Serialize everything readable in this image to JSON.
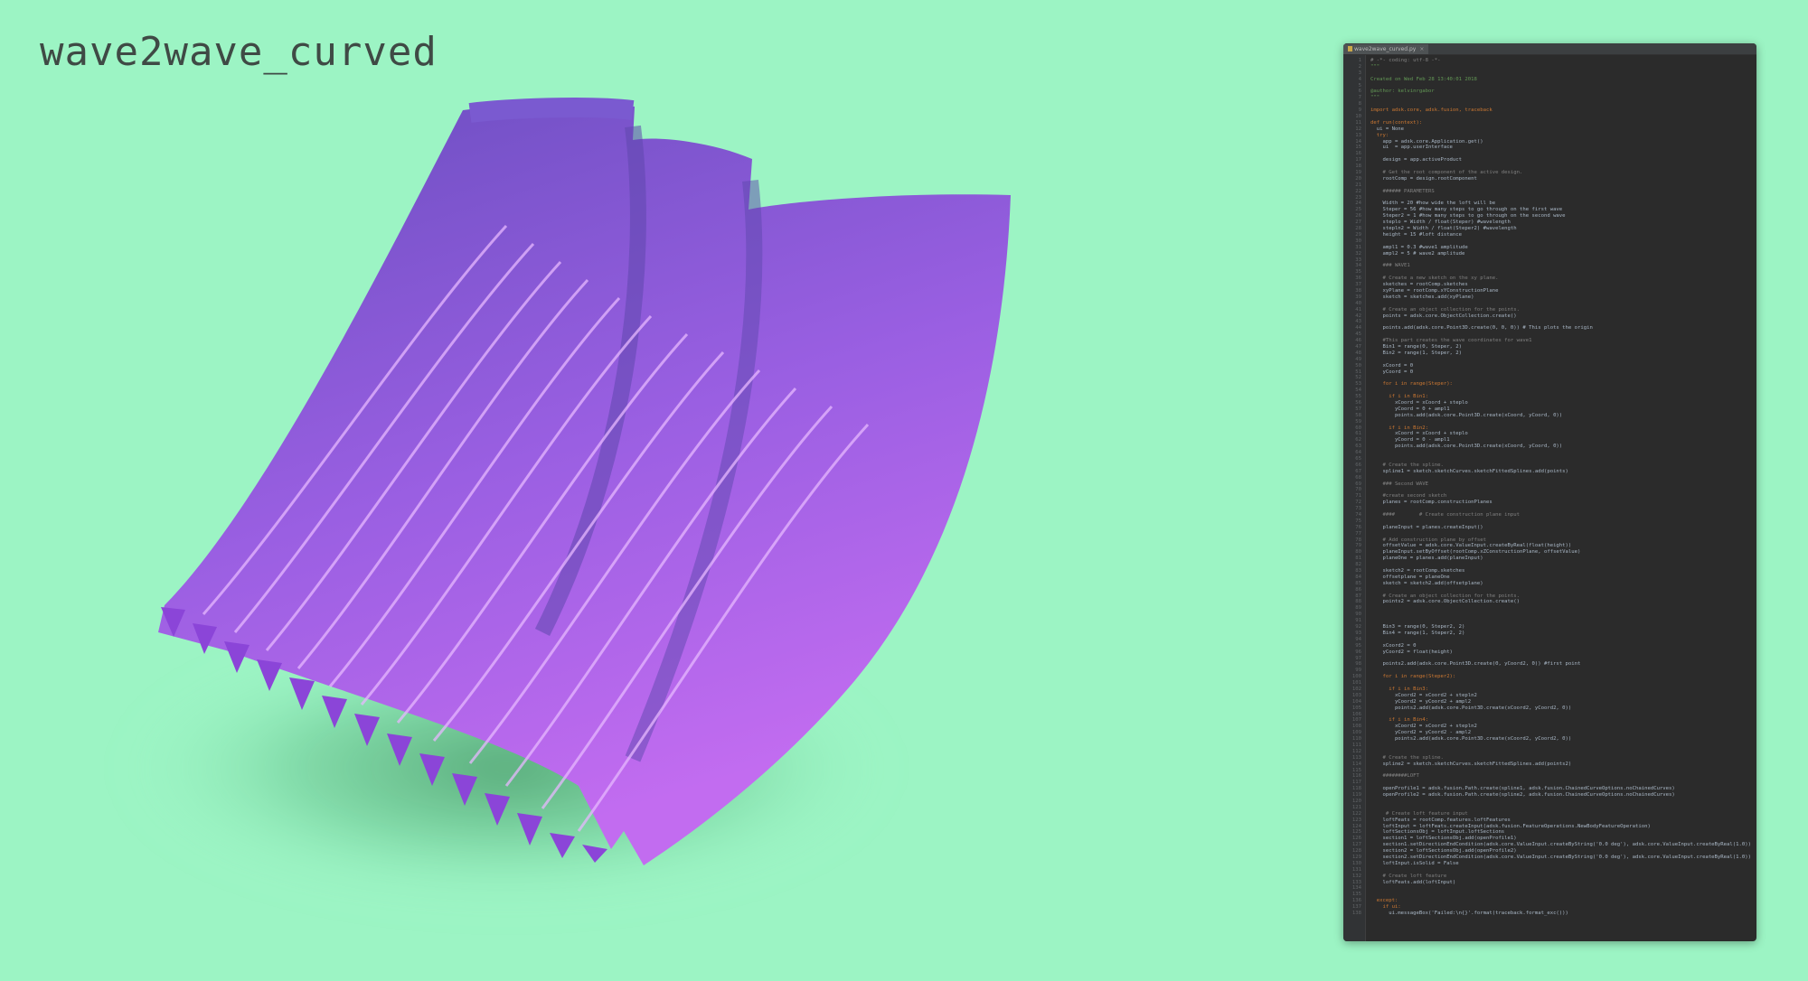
{
  "title": "wave2wave_curved",
  "colors": {
    "background": "#9cf4c4",
    "surface_dark": "#6a4ec0",
    "surface_mid": "#9a5fe2",
    "surface_light": "#c26cf0",
    "editor_bg": "#2b2b2b"
  },
  "editor": {
    "tab_label": "wave2wave_curved.py",
    "tab_close_glyph": "×",
    "lines": [
      {
        "n": "1",
        "text": "# -*- coding: utf-8 -*-",
        "style": "comment"
      },
      {
        "n": "2",
        "text": "\"\"\"",
        "style": "doc"
      },
      {
        "n": "3",
        "text": "",
        "style": "plain"
      },
      {
        "n": "4",
        "text": "Created on Wed Feb 28 13:40:01 2018",
        "style": "doc"
      },
      {
        "n": "5",
        "text": "",
        "style": "plain"
      },
      {
        "n": "6",
        "text": "@author: kelvinrgabor",
        "style": "doc"
      },
      {
        "n": "7",
        "text": "\"\"\"",
        "style": "doc"
      },
      {
        "n": "8",
        "text": "",
        "style": "plain"
      },
      {
        "n": "9",
        "text": "import adsk.core, adsk.fusion, traceback",
        "style": "kw"
      },
      {
        "n": "10",
        "text": "",
        "style": "plain"
      },
      {
        "n": "11",
        "text": "def run(context):",
        "style": "kw"
      },
      {
        "n": "12",
        "text": "  ui = None",
        "style": "plain"
      },
      {
        "n": "13",
        "text": "  try:",
        "style": "kw"
      },
      {
        "n": "14",
        "text": "    app = adsk.core.Application.get()",
        "style": "plain"
      },
      {
        "n": "15",
        "text": "    ui  = app.userInterface",
        "style": "plain"
      },
      {
        "n": "16",
        "text": "",
        "style": "plain"
      },
      {
        "n": "17",
        "text": "    design = app.activeProduct",
        "style": "plain"
      },
      {
        "n": "18",
        "text": "",
        "style": "plain"
      },
      {
        "n": "19",
        "text": "    # Get the root component of the active design.",
        "style": "comment"
      },
      {
        "n": "20",
        "text": "    rootComp = design.rootComponent",
        "style": "plain"
      },
      {
        "n": "21",
        "text": "",
        "style": "plain"
      },
      {
        "n": "22",
        "text": "    ###### PARAMETERS",
        "style": "comment"
      },
      {
        "n": "23",
        "text": "",
        "style": "plain"
      },
      {
        "n": "24",
        "text": "    Width = 20 #how wide the loft will be",
        "style": "plain"
      },
      {
        "n": "25",
        "text": "    Steper = 56 #how many steps to go through on the first wave",
        "style": "plain"
      },
      {
        "n": "26",
        "text": "    Steper2 = 1 #how many steps to go through on the second wave",
        "style": "plain"
      },
      {
        "n": "27",
        "text": "    steplo = Width / float(Steper) #wavelength",
        "style": "plain"
      },
      {
        "n": "28",
        "text": "    stepln2 = Width / float(Steper2) #wavelength",
        "style": "plain"
      },
      {
        "n": "29",
        "text": "    height = 15 #loft distance",
        "style": "plain"
      },
      {
        "n": "30",
        "text": "",
        "style": "plain"
      },
      {
        "n": "31",
        "text": "    ampl1 = 0.3 #wave1 amplitude",
        "style": "plain"
      },
      {
        "n": "32",
        "text": "    ampl2 = 5 # wave2 amplitude",
        "style": "plain"
      },
      {
        "n": "33",
        "text": "",
        "style": "plain"
      },
      {
        "n": "34",
        "text": "    ### WAVE1",
        "style": "comment"
      },
      {
        "n": "35",
        "text": "",
        "style": "plain"
      },
      {
        "n": "36",
        "text": "    # Create a new sketch on the xy plane.",
        "style": "comment"
      },
      {
        "n": "37",
        "text": "    sketches = rootComp.sketches",
        "style": "plain"
      },
      {
        "n": "38",
        "text": "    xyPlane = rootComp.xYConstructionPlane",
        "style": "plain"
      },
      {
        "n": "39",
        "text": "    sketch = sketches.add(xyPlane)",
        "style": "plain"
      },
      {
        "n": "40",
        "text": "",
        "style": "plain"
      },
      {
        "n": "41",
        "text": "    # Create an object collection for the points.",
        "style": "comment"
      },
      {
        "n": "42",
        "text": "    points = adsk.core.ObjectCollection.create()",
        "style": "plain"
      },
      {
        "n": "43",
        "text": "",
        "style": "plain"
      },
      {
        "n": "44",
        "text": "    points.add(adsk.core.Point3D.create(0, 0, 0)) # This plots the origin",
        "style": "plain"
      },
      {
        "n": "45",
        "text": "",
        "style": "plain"
      },
      {
        "n": "46",
        "text": "    #This part creates the wave coordinates for wave1",
        "style": "comment"
      },
      {
        "n": "47",
        "text": "    Bin1 = range(0, Steper, 2)",
        "style": "plain"
      },
      {
        "n": "48",
        "text": "    Bin2 = range(1, Steper, 2)",
        "style": "plain"
      },
      {
        "n": "49",
        "text": "",
        "style": "plain"
      },
      {
        "n": "50",
        "text": "    xCoord = 0",
        "style": "plain"
      },
      {
        "n": "51",
        "text": "    yCoord = 0",
        "style": "plain"
      },
      {
        "n": "52",
        "text": "",
        "style": "plain"
      },
      {
        "n": "53",
        "text": "    for i in range(Steper):",
        "style": "kw"
      },
      {
        "n": "54",
        "text": "",
        "style": "plain"
      },
      {
        "n": "55",
        "text": "      if i in Bin1:",
        "style": "kw"
      },
      {
        "n": "56",
        "text": "        xCoord = xCoord + steplo",
        "style": "plain"
      },
      {
        "n": "57",
        "text": "        yCoord = 0 + ampl1",
        "style": "plain"
      },
      {
        "n": "58",
        "text": "        points.add(adsk.core.Point3D.create(xCoord, yCoord, 0))",
        "style": "plain"
      },
      {
        "n": "59",
        "text": "",
        "style": "plain"
      },
      {
        "n": "60",
        "text": "      if i in Bin2:",
        "style": "kw"
      },
      {
        "n": "61",
        "text": "        xCoord = xCoord + steplo",
        "style": "plain"
      },
      {
        "n": "62",
        "text": "        yCoord = 0 - ampl1",
        "style": "plain"
      },
      {
        "n": "63",
        "text": "        points.add(adsk.core.Point3D.create(xCoord, yCoord, 0))",
        "style": "plain"
      },
      {
        "n": "64",
        "text": "",
        "style": "plain"
      },
      {
        "n": "65",
        "text": "",
        "style": "plain"
      },
      {
        "n": "66",
        "text": "    # Create the spline.",
        "style": "comment"
      },
      {
        "n": "67",
        "text": "    spline1 = sketch.sketchCurves.sketchFittedSplines.add(points)",
        "style": "plain"
      },
      {
        "n": "68",
        "text": "",
        "style": "plain"
      },
      {
        "n": "69",
        "text": "    ### Second WAVE",
        "style": "comment"
      },
      {
        "n": "70",
        "text": "",
        "style": "plain"
      },
      {
        "n": "71",
        "text": "    #create second sketch",
        "style": "comment"
      },
      {
        "n": "72",
        "text": "    planes = rootComp.constructionPlanes",
        "style": "plain"
      },
      {
        "n": "73",
        "text": "",
        "style": "plain"
      },
      {
        "n": "74",
        "text": "    ####        # Create construction plane input",
        "style": "comment"
      },
      {
        "n": "75",
        "text": "",
        "style": "plain"
      },
      {
        "n": "76",
        "text": "    planeInput = planes.createInput()",
        "style": "plain"
      },
      {
        "n": "77",
        "text": "",
        "style": "plain"
      },
      {
        "n": "78",
        "text": "    # Add construction plane by offset",
        "style": "comment"
      },
      {
        "n": "79",
        "text": "    offsetValue = adsk.core.ValueInput.createByReal(float(height))",
        "style": "plain"
      },
      {
        "n": "80",
        "text": "    planeInput.setByOffset(rootComp.xZConstructionPlane, offsetValue)",
        "style": "plain"
      },
      {
        "n": "81",
        "text": "    planeOne = planes.add(planeInput)",
        "style": "plain"
      },
      {
        "n": "82",
        "text": "",
        "style": "plain"
      },
      {
        "n": "83",
        "text": "    sketch2 = rootComp.sketches",
        "style": "plain"
      },
      {
        "n": "84",
        "text": "    offsetplane = planeOne",
        "style": "plain"
      },
      {
        "n": "85",
        "text": "    sketch = sketch2.add(offsetplane)",
        "style": "plain"
      },
      {
        "n": "86",
        "text": "",
        "style": "plain"
      },
      {
        "n": "87",
        "text": "    # Create an object collection for the points.",
        "style": "comment"
      },
      {
        "n": "88",
        "text": "    points2 = adsk.core.ObjectCollection.create()",
        "style": "plain"
      },
      {
        "n": "89",
        "text": "",
        "style": "plain"
      },
      {
        "n": "90",
        "text": "",
        "style": "plain"
      },
      {
        "n": "91",
        "text": "",
        "style": "plain"
      },
      {
        "n": "92",
        "text": "    Bin3 = range(0, Steper2, 2)",
        "style": "plain"
      },
      {
        "n": "93",
        "text": "    Bin4 = range(1, Steper2, 2)",
        "style": "plain"
      },
      {
        "n": "94",
        "text": "",
        "style": "plain"
      },
      {
        "n": "95",
        "text": "    xCoord2 = 0",
        "style": "plain"
      },
      {
        "n": "96",
        "text": "    yCoord2 = float(height)",
        "style": "plain"
      },
      {
        "n": "97",
        "text": "",
        "style": "plain"
      },
      {
        "n": "98",
        "text": "    points2.add(adsk.core.Point3D.create(0, yCoord2, 0)) #first point",
        "style": "plain"
      },
      {
        "n": "99",
        "text": "",
        "style": "plain"
      },
      {
        "n": "100",
        "text": "    for i in range(Steper2):",
        "style": "kw"
      },
      {
        "n": "101",
        "text": "",
        "style": "plain"
      },
      {
        "n": "102",
        "text": "      if i in Bin3:",
        "style": "kw"
      },
      {
        "n": "103",
        "text": "        xCoord2 = xCoord2 + stepln2",
        "style": "plain"
      },
      {
        "n": "104",
        "text": "        yCoord2 = yCoord2 + ampl2",
        "style": "plain"
      },
      {
        "n": "105",
        "text": "        points2.add(adsk.core.Point3D.create(xCoord2, yCoord2, 0))",
        "style": "plain"
      },
      {
        "n": "106",
        "text": "",
        "style": "plain"
      },
      {
        "n": "107",
        "text": "      if i in Bin4:",
        "style": "kw"
      },
      {
        "n": "108",
        "text": "        xCoord2 = xCoord2 + stepln2",
        "style": "plain"
      },
      {
        "n": "109",
        "text": "        yCoord2 = yCoord2 - ampl2",
        "style": "plain"
      },
      {
        "n": "110",
        "text": "        points2.add(adsk.core.Point3D.create(xCoord2, yCoord2, 0))",
        "style": "plain"
      },
      {
        "n": "111",
        "text": "",
        "style": "plain"
      },
      {
        "n": "112",
        "text": "",
        "style": "plain"
      },
      {
        "n": "113",
        "text": "    # Create the spline.",
        "style": "comment"
      },
      {
        "n": "114",
        "text": "    spline2 = sketch.sketchCurves.sketchFittedSplines.add(points2)",
        "style": "plain"
      },
      {
        "n": "115",
        "text": "",
        "style": "plain"
      },
      {
        "n": "116",
        "text": "    ########LOFT",
        "style": "comment"
      },
      {
        "n": "117",
        "text": "",
        "style": "plain"
      },
      {
        "n": "118",
        "text": "    openProfile1 = adsk.fusion.Path.create(spline1, adsk.fusion.ChainedCurveOptions.noChainedCurves)",
        "style": "plain"
      },
      {
        "n": "119",
        "text": "    openProfile2 = adsk.fusion.Path.create(spline2, adsk.fusion.ChainedCurveOptions.noChainedCurves)",
        "style": "plain"
      },
      {
        "n": "120",
        "text": "",
        "style": "plain"
      },
      {
        "n": "121",
        "text": "",
        "style": "plain"
      },
      {
        "n": "122",
        "text": "     # Create loft feature input",
        "style": "comment"
      },
      {
        "n": "123",
        "text": "    loftFeats = rootComp.features.loftFeatures",
        "style": "plain"
      },
      {
        "n": "124",
        "text": "    loftInput = loftFeats.createInput(adsk.fusion.FeatureOperations.NewBodyFeatureOperation)",
        "style": "plain"
      },
      {
        "n": "125",
        "text": "    loftSectionsObj = loftInput.loftSections",
        "style": "plain"
      },
      {
        "n": "126",
        "text": "    section1 = loftSectionsObj.add(openProfile1)",
        "style": "plain"
      },
      {
        "n": "127",
        "text": "    section1.setDirectionEndCondition(adsk.core.ValueInput.createByString('0.0 deg'), adsk.core.ValueInput.createByReal(1.0))",
        "style": "plain"
      },
      {
        "n": "128",
        "text": "    section2 = loftSectionsObj.add(openProfile2)",
        "style": "plain"
      },
      {
        "n": "129",
        "text": "    section2.setDirectionEndCondition(adsk.core.ValueInput.createByString('0.0 deg'), adsk.core.ValueInput.createByReal(1.0))",
        "style": "plain"
      },
      {
        "n": "130",
        "text": "    loftInput.isSolid = False",
        "style": "plain"
      },
      {
        "n": "131",
        "text": "",
        "style": "plain"
      },
      {
        "n": "132",
        "text": "    # Create loft feature",
        "style": "comment"
      },
      {
        "n": "133",
        "text": "    loftFeats.add(loftInput)",
        "style": "plain"
      },
      {
        "n": "134",
        "text": "",
        "style": "plain"
      },
      {
        "n": "135",
        "text": "",
        "style": "plain"
      },
      {
        "n": "136",
        "text": "  except:",
        "style": "kw"
      },
      {
        "n": "137",
        "text": "    if ui:",
        "style": "kw"
      },
      {
        "n": "138",
        "text": "      ui.messageBox('Failed:\\n{}'.format(traceback.format_exc()))",
        "style": "plain"
      }
    ]
  }
}
